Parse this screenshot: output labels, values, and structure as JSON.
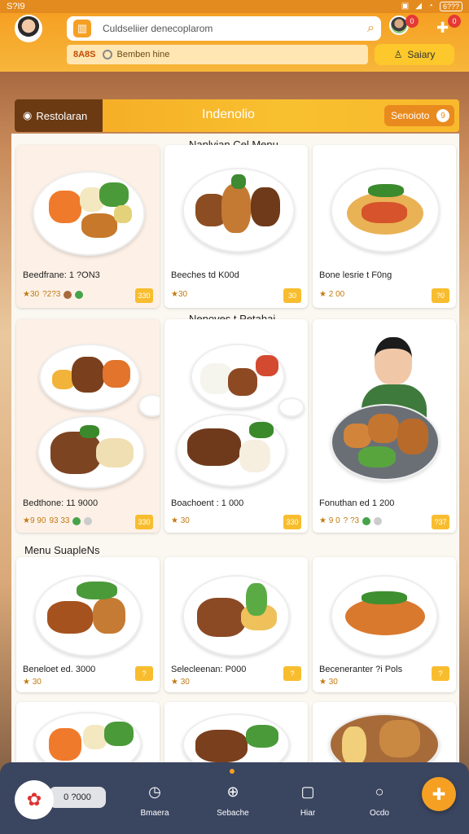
{
  "status": {
    "time": "S?I9",
    "battery": "6???"
  },
  "header": {
    "search_placeholder": "Culdseliier denecoplarom",
    "code_label": "8A8S",
    "sub_label": "Bemben hine",
    "survey_label": "Saiary",
    "notifications": [
      "0",
      "0"
    ]
  },
  "category": {
    "left_label": "Restolaran",
    "title": "Indenolio",
    "right_label": "Senoioto",
    "right_count": "9"
  },
  "sections": [
    {
      "title": "Nanlvian Cel Menu"
    },
    {
      "title": "Nenoves t Petahai"
    },
    {
      "title": "Menu SuapleNs"
    }
  ],
  "cards": [
    {
      "name": "Beedfrane: 1 ?ON3",
      "meta_a": "★30",
      "meta_b": "?2?3",
      "btn": "330"
    },
    {
      "name": "Beeches td K00d",
      "meta_a": "★30",
      "meta_b": "",
      "btn": "30"
    },
    {
      "name": "Bone lesrie t F0ng",
      "meta_a": "★ 2 00",
      "meta_b": "",
      "btn": "?0"
    },
    {
      "name": "Bedthone: 11 9000",
      "meta_a": "★9 90",
      "meta_b": "93 33",
      "btn": "330"
    },
    {
      "name": "Boachoent : 1 000",
      "meta_a": "★ 30",
      "meta_b": "",
      "btn": "330"
    },
    {
      "name": "Fonuthan ed 1 200",
      "meta_a": "★ 9 0",
      "meta_b": "? ?3",
      "btn": "?37"
    },
    {
      "name": "Beneloet ed. 3000",
      "meta_a": "★ 30",
      "meta_b": "",
      "btn": "?"
    },
    {
      "name": "Selecleenan: P000",
      "meta_a": "★ 30",
      "meta_b": "",
      "btn": "?"
    },
    {
      "name": "Beceneranter ?i Pols",
      "meta_a": "★ 30",
      "meta_b": "",
      "btn": "?"
    }
  ],
  "bottom_nav": {
    "price": "0 ?000",
    "items": [
      "Bmaera",
      "Sebache",
      "Hiar",
      "Ocdo"
    ]
  },
  "icons": [
    "search-icon",
    "puzzle-icon",
    "star-icon",
    "home-icon"
  ],
  "colors": {
    "accent": "#f5a023",
    "nav": "#3a4560",
    "brown": "#6b3a13"
  }
}
